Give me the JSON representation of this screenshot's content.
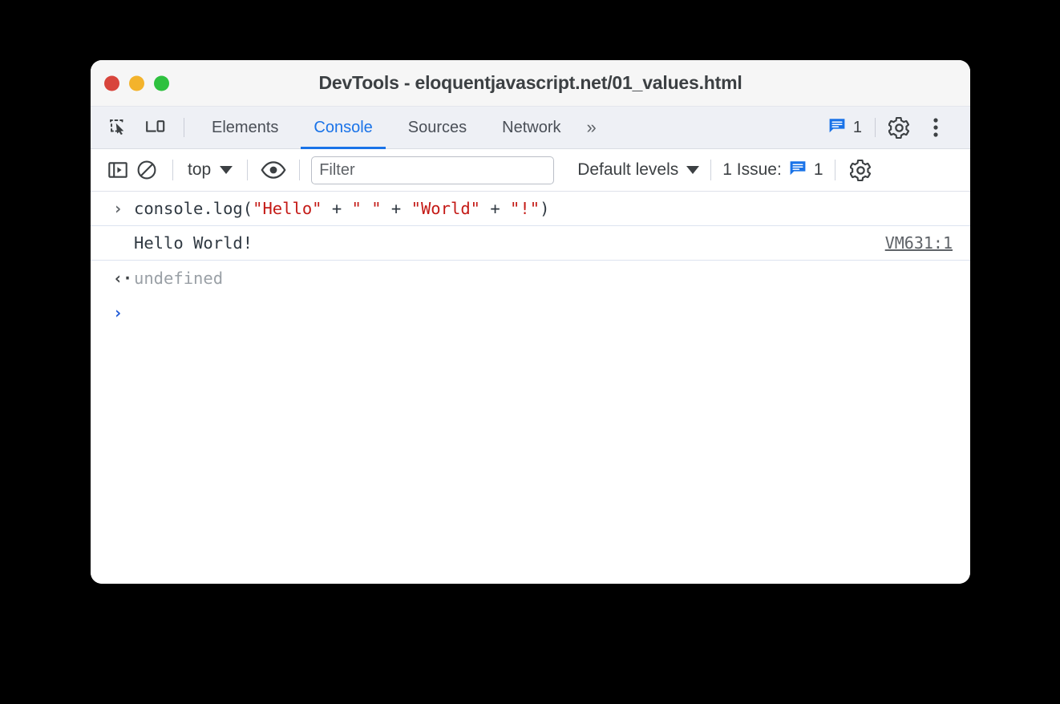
{
  "window": {
    "title": "DevTools - eloquentjavascript.net/01_values.html",
    "traffic_lights": [
      {
        "name": "close",
        "color": "#d8453c"
      },
      {
        "name": "minimize",
        "color": "#f3b32c"
      },
      {
        "name": "maximize",
        "color": "#2ec13f"
      }
    ]
  },
  "tabbar": {
    "icons": [
      {
        "name": "inspect-element-icon"
      },
      {
        "name": "device-toolbar-icon"
      }
    ],
    "tabs": [
      {
        "label": "Elements",
        "active": false
      },
      {
        "label": "Console",
        "active": true
      },
      {
        "label": "Sources",
        "active": false
      },
      {
        "label": "Network",
        "active": false
      }
    ],
    "more_tabs_label": "»",
    "issue_count": "1",
    "settings_label": "Settings",
    "more_options_label": "Customize and control DevTools"
  },
  "console_toolbar": {
    "sidebar_toggle_label": "Show console sidebar",
    "clear_console_label": "Clear console",
    "context": "top",
    "eye_label": "Create live expression",
    "filter_placeholder": "Filter",
    "filter_value": "",
    "levels": "Default levels",
    "issues_text": "1 Issue:",
    "issues_count": "1",
    "settings_label": "Console settings"
  },
  "console": {
    "rows": [
      {
        "type": "input",
        "gutter": "›",
        "tokens": [
          {
            "text": "console.log(",
            "kind": "code"
          },
          {
            "text": "\"Hello\"",
            "kind": "string"
          },
          {
            "text": " + ",
            "kind": "code"
          },
          {
            "text": "\" \"",
            "kind": "string"
          },
          {
            "text": " + ",
            "kind": "code"
          },
          {
            "text": "\"World\"",
            "kind": "string"
          },
          {
            "text": " + ",
            "kind": "code"
          },
          {
            "text": "\"!\"",
            "kind": "string"
          },
          {
            "text": ")",
            "kind": "code"
          }
        ]
      },
      {
        "type": "output",
        "gutter": "",
        "text": "Hello World!",
        "source_link": "VM631:1"
      },
      {
        "type": "result",
        "gutter": "‹·",
        "text": "undefined"
      },
      {
        "type": "prompt",
        "gutter": "›",
        "text": ""
      }
    ]
  },
  "colors": {
    "accent": "#1a73e8",
    "string_literal": "#c41a16",
    "undefined_text": "#9aa0a6",
    "titlebar_bg": "#f6f6f6",
    "tabbar_bg": "#eef0f5"
  }
}
